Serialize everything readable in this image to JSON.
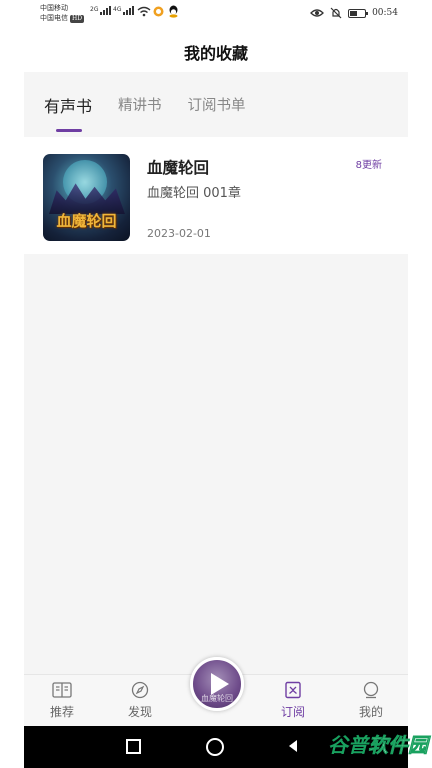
{
  "status_bar": {
    "carrier_1": "中国移动",
    "carrier_2": "中国电信",
    "hd_badge": "HD",
    "sig_1_label": "2G",
    "sig_2_label": "4G",
    "time": "00:54",
    "battery_level": 0.5
  },
  "header": {
    "title": "我的收藏"
  },
  "tabs": [
    {
      "label": "有声书",
      "active": true
    },
    {
      "label": "精讲书",
      "active": false
    },
    {
      "label": "订阅书单",
      "active": false
    }
  ],
  "books": [
    {
      "title": "血魔轮回",
      "subtitle": "血魔轮回 001章",
      "date": "2023-02-01",
      "update_badge": "8更新",
      "cover_text": "血魔轮回"
    }
  ],
  "bottom_nav": [
    {
      "label": "推荐",
      "icon": "book-open-icon",
      "active": false
    },
    {
      "label": "发现",
      "icon": "compass-icon",
      "active": false
    },
    {
      "label": "订阅",
      "icon": "bookmark-doc-icon",
      "active": true
    },
    {
      "label": "我的",
      "icon": "person-icon",
      "active": false
    }
  ],
  "player": {
    "cover_text": "血魔轮回"
  },
  "watermark": {
    "part1": "谷普",
    "part2": "软件园"
  },
  "colors": {
    "accent": "#6f3ea3",
    "panel_bg": "#f5f5f5"
  }
}
